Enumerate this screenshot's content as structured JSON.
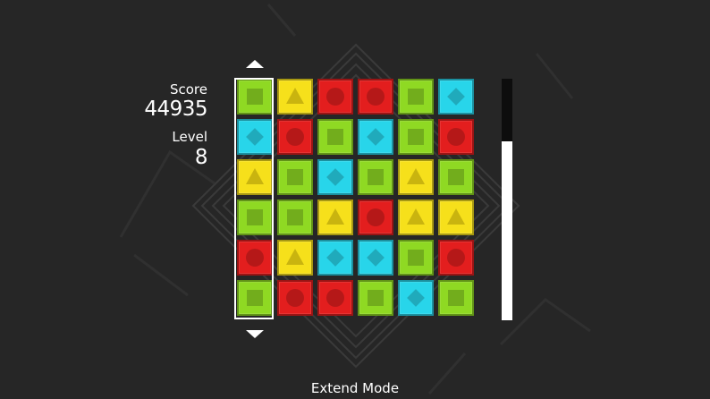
{
  "hud": {
    "score_label": "Score",
    "score_value": "44935",
    "level_label": "Level",
    "level_value": "8"
  },
  "mode_label": "Extend Mode",
  "timer": {
    "fill_fraction": 0.74
  },
  "selected_column": 0,
  "colors": {
    "background": "#262626",
    "green": "#8fd923",
    "yellow": "#f6e01b",
    "red": "#e31e1e",
    "cyan": "#28d5ea"
  },
  "shape_by_color": {
    "green": "square",
    "yellow": "triangle",
    "red": "circle",
    "cyan": "diamond"
  },
  "board": [
    [
      "green",
      "yellow",
      "red",
      "red",
      "green",
      "cyan"
    ],
    [
      "cyan",
      "red",
      "green",
      "cyan",
      "green",
      "red"
    ],
    [
      "yellow",
      "green",
      "cyan",
      "green",
      "yellow",
      "green"
    ],
    [
      "green",
      "green",
      "yellow",
      "red",
      "yellow",
      "yellow"
    ],
    [
      "red",
      "yellow",
      "cyan",
      "cyan",
      "green",
      "red"
    ],
    [
      "green",
      "red",
      "red",
      "green",
      "cyan",
      "green"
    ]
  ]
}
